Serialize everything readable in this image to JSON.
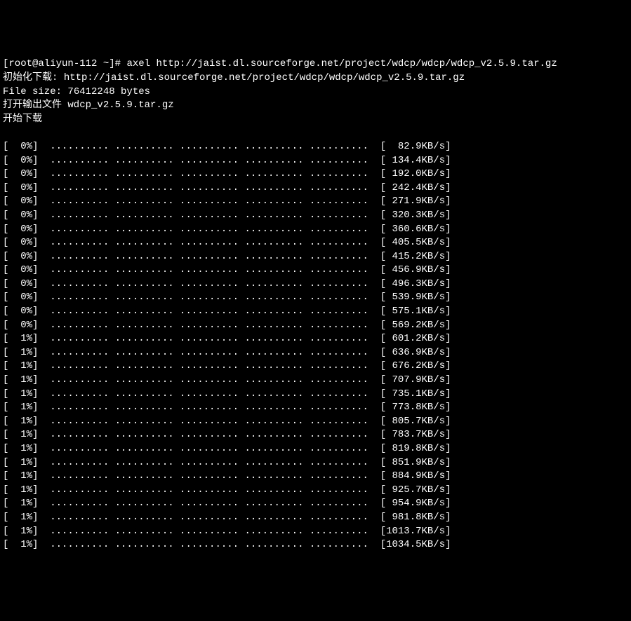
{
  "header": {
    "prompt": "[root@aliyun-112 ~]# ",
    "command": "axel http://jaist.dl.sourceforge.net/project/wdcp/wdcp/wdcp_v2.5.9.tar.gz",
    "init_label": "初始化下载: ",
    "init_url": "http://jaist.dl.sourceforge.net/project/wdcp/wdcp/wdcp_v2.5.9.tar.gz",
    "filesize_label": "File size: ",
    "filesize_value": "76412248 bytes",
    "open_output_label": "打开输出文件 ",
    "output_filename": "wdcp_v2.5.9.tar.gz",
    "start_download": "开始下载"
  },
  "progress_dots": ".......... .......... .......... .......... ..........  ",
  "rows": [
    {
      "percent": "  0%",
      "speed": "  82.9KB/s"
    },
    {
      "percent": "  0%",
      "speed": " 134.4KB/s"
    },
    {
      "percent": "  0%",
      "speed": " 192.0KB/s"
    },
    {
      "percent": "  0%",
      "speed": " 242.4KB/s"
    },
    {
      "percent": "  0%",
      "speed": " 271.9KB/s"
    },
    {
      "percent": "  0%",
      "speed": " 320.3KB/s"
    },
    {
      "percent": "  0%",
      "speed": " 360.6KB/s"
    },
    {
      "percent": "  0%",
      "speed": " 405.5KB/s"
    },
    {
      "percent": "  0%",
      "speed": " 415.2KB/s"
    },
    {
      "percent": "  0%",
      "speed": " 456.9KB/s"
    },
    {
      "percent": "  0%",
      "speed": " 496.3KB/s"
    },
    {
      "percent": "  0%",
      "speed": " 539.9KB/s"
    },
    {
      "percent": "  0%",
      "speed": " 575.1KB/s"
    },
    {
      "percent": "  0%",
      "speed": " 569.2KB/s"
    },
    {
      "percent": "  1%",
      "speed": " 601.2KB/s"
    },
    {
      "percent": "  1%",
      "speed": " 636.9KB/s"
    },
    {
      "percent": "  1%",
      "speed": " 676.2KB/s"
    },
    {
      "percent": "  1%",
      "speed": " 707.9KB/s"
    },
    {
      "percent": "  1%",
      "speed": " 735.1KB/s"
    },
    {
      "percent": "  1%",
      "speed": " 773.8KB/s"
    },
    {
      "percent": "  1%",
      "speed": " 805.7KB/s"
    },
    {
      "percent": "  1%",
      "speed": " 783.7KB/s"
    },
    {
      "percent": "  1%",
      "speed": " 819.8KB/s"
    },
    {
      "percent": "  1%",
      "speed": " 851.9KB/s"
    },
    {
      "percent": "  1%",
      "speed": " 884.9KB/s"
    },
    {
      "percent": "  1%",
      "speed": " 925.7KB/s"
    },
    {
      "percent": "  1%",
      "speed": " 954.9KB/s"
    },
    {
      "percent": "  1%",
      "speed": " 981.8KB/s"
    },
    {
      "percent": "  1%",
      "speed": "1013.7KB/s"
    },
    {
      "percent": "  1%",
      "speed": "1034.5KB/s"
    }
  ]
}
